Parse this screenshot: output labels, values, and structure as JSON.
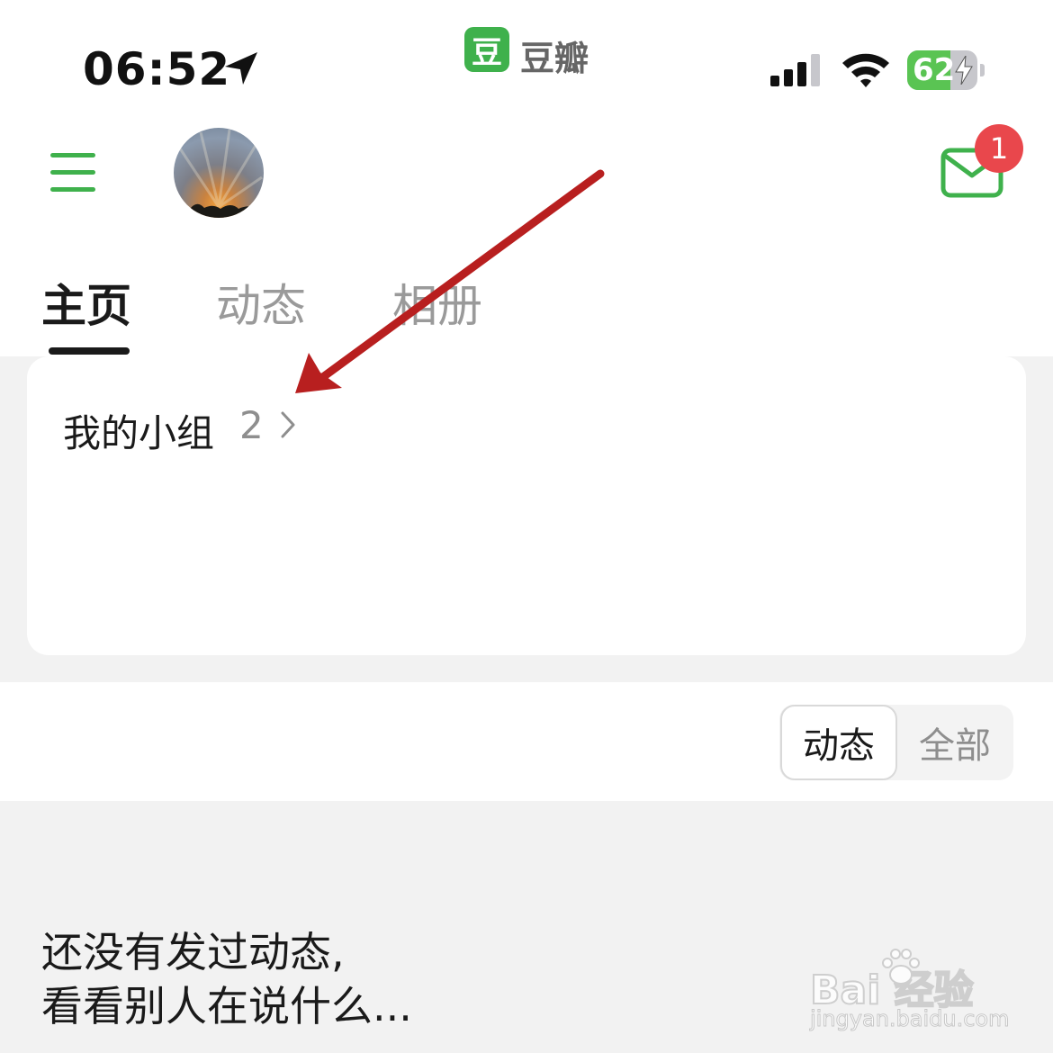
{
  "status_bar": {
    "time": "06:52",
    "app_badge_char": "豆",
    "app_name": "豆瓣",
    "battery_percent": 62,
    "battery_label": "62"
  },
  "header": {
    "mail_badge_count": "1",
    "accent_color": "#3fb14c",
    "badge_color": "#e9474c"
  },
  "tabs": [
    {
      "label": "主页",
      "active": true
    },
    {
      "label": "动态",
      "active": false
    },
    {
      "label": "相册",
      "active": false
    }
  ],
  "groups_card": {
    "title": "我的小组",
    "count": "2"
  },
  "feed_filter": {
    "options": [
      "动态",
      "全部"
    ],
    "selected": "动态"
  },
  "empty_state": {
    "line1": "还没有发过动态,",
    "line2": "看看别人在说什么..."
  },
  "watermark": {
    "brand": "Bai  经验",
    "url": "jingyan.baidu.com"
  },
  "annotation": {
    "arrow_color": "#b81f1f"
  }
}
